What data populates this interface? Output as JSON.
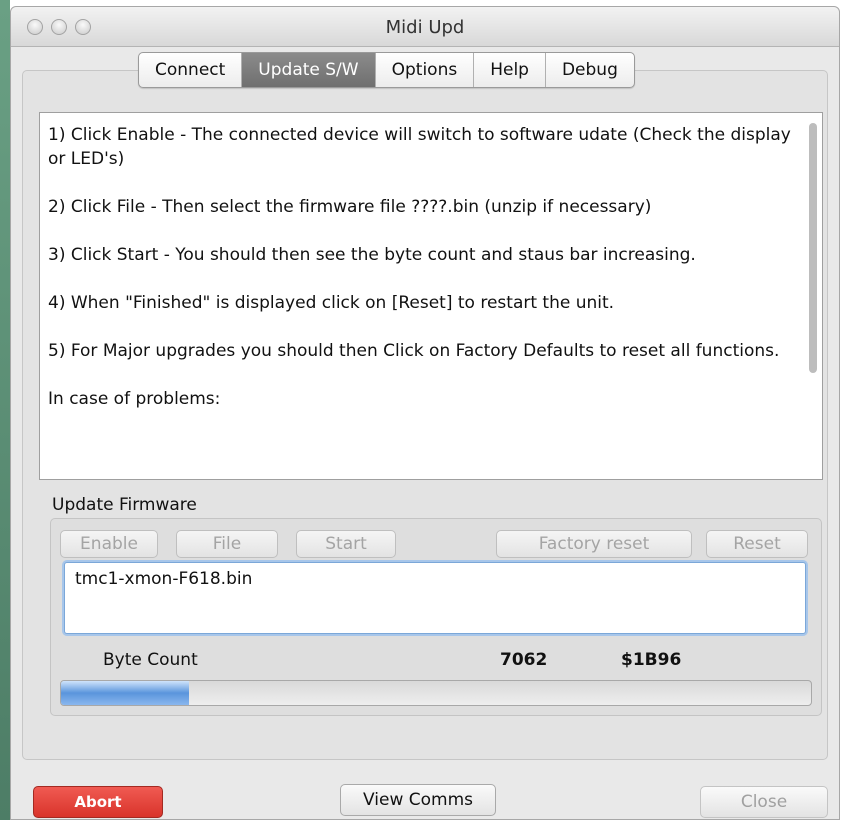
{
  "window": {
    "title": "Midi  Upd"
  },
  "tabs": [
    {
      "label": "Connect",
      "active": false
    },
    {
      "label": "Update S/W",
      "active": true
    },
    {
      "label": "Options",
      "active": false
    },
    {
      "label": "Help",
      "active": false
    },
    {
      "label": "Debug",
      "active": false
    }
  ],
  "instructions": [
    "1) Click Enable - The connected device will switch to software udate (Check the display or LED's)",
    "2) Click File - Then select the firmware file ????.bin (unzip if necessary)",
    "3) Click Start - You should then see the byte count and staus bar increasing.",
    "4) When \"Finished\" is displayed click on [Reset] to restart the unit.",
    "5) For Major upgrades you should then Click on Factory Defaults to reset all functions.",
    "In case of problems:"
  ],
  "firmware": {
    "section_label": "Update Firmware",
    "buttons": {
      "enable": "Enable",
      "file": "File",
      "start": "Start",
      "factory_reset": "Factory reset",
      "reset": "Reset"
    },
    "filename": "tmc1-xmon-F618.bin",
    "byte_count_label": "Byte Count",
    "byte_count": "7062",
    "byte_count_hex": "$1B96",
    "progress": 0.17
  },
  "footer": {
    "abort": "Abort",
    "view_comms": "View Comms",
    "close": "Close"
  },
  "colors": {
    "abort": "#d9342b",
    "active_tab": "#7a7a7a",
    "progress_fill": "#5a95dc"
  }
}
